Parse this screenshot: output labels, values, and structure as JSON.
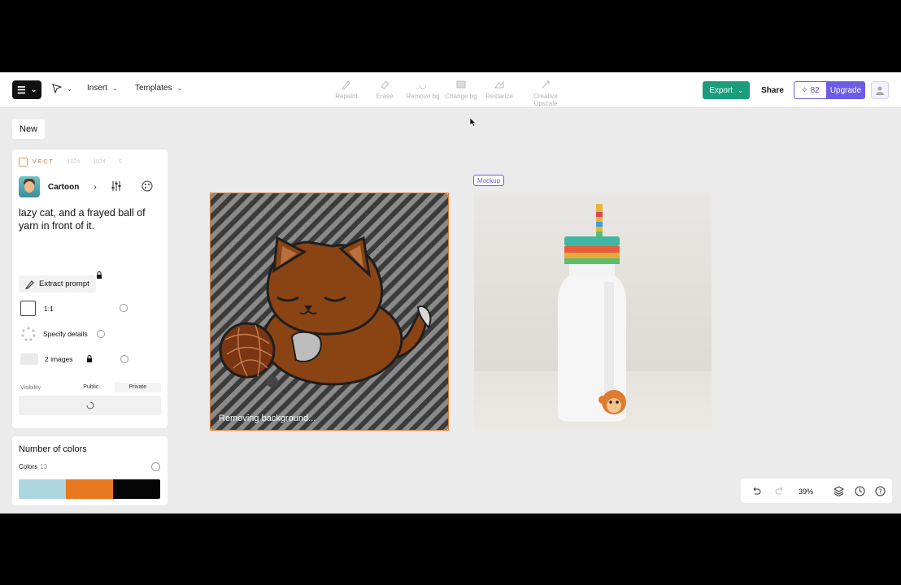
{
  "toolbar": {
    "insert_label": "Insert",
    "templates_label": "Templates",
    "tools": [
      {
        "label": "Repaint",
        "icon": "brush-icon"
      },
      {
        "label": "Erase",
        "icon": "eraser-icon"
      },
      {
        "label": "Remove bg",
        "icon": "remove-bg-icon"
      },
      {
        "label": "Change bg",
        "icon": "change-bg-icon"
      },
      {
        "label": "Restarize",
        "icon": "restarize-icon"
      },
      {
        "label": "Creative Upscale",
        "icon": "upscale-icon"
      }
    ],
    "export_label": "Export",
    "share_label": "Share",
    "credits": "82",
    "upgrade_label": "Upgrade"
  },
  "sidebar": {
    "new_label": "New",
    "model": {
      "name": "VECT",
      "width": "1024",
      "height": "1024",
      "extra": "0"
    },
    "style_label": "Cartoon",
    "prompt": "lazy cat, and a frayed ball of yarn in front of it.",
    "extract_label": "Extract prompt",
    "ratio_label": "1:1",
    "details_label": "Specify details",
    "images_label": "2 images",
    "visibility_label": "Visibility",
    "visibility_options": [
      "Public",
      "Private"
    ]
  },
  "colors_panel": {
    "title": "Number of colors",
    "label": "Colors",
    "count": "13",
    "swatches": [
      "#aed6e2",
      "#e8781f",
      "#050505"
    ]
  },
  "canvas": {
    "status_text": "Removing background...",
    "mockup_tag": "Mockup"
  },
  "bottom_bar": {
    "zoom": "39%"
  }
}
